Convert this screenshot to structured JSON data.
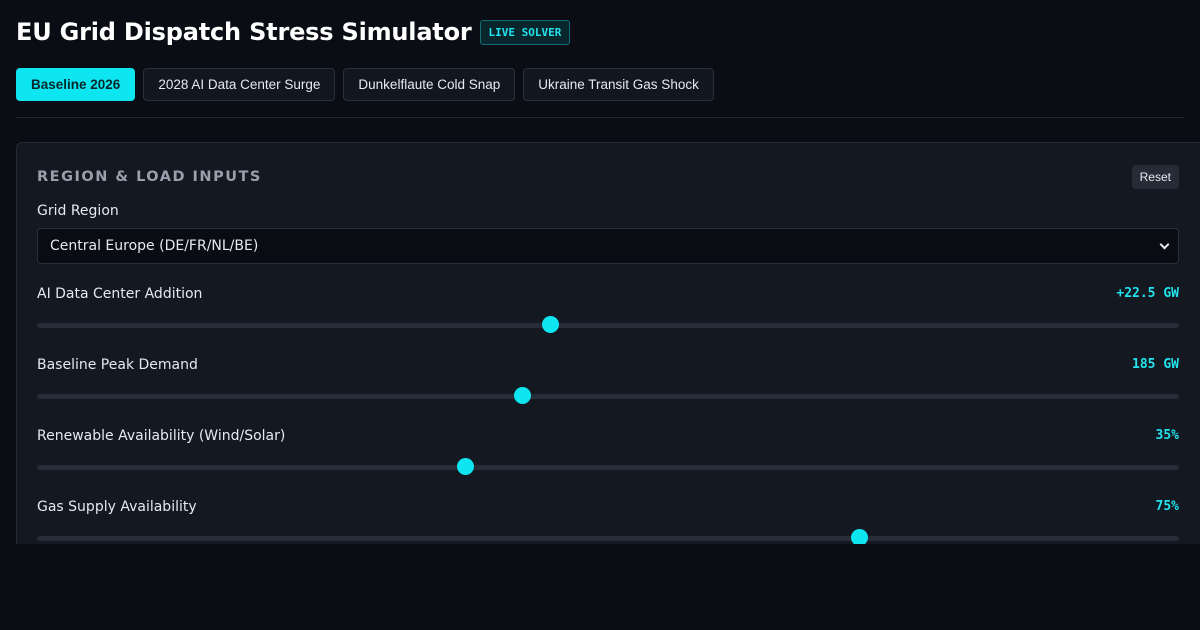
{
  "header": {
    "title": "EU Grid Dispatch Stress Simulator",
    "badge": "LIVE SOLVER"
  },
  "tabs": [
    {
      "label": "Baseline 2026",
      "active": true
    },
    {
      "label": "2028 AI Data Center Surge",
      "active": false
    },
    {
      "label": "Dunkelflaute Cold Snap",
      "active": false
    },
    {
      "label": "Ukraine Transit Gas Shock",
      "active": false
    }
  ],
  "panel": {
    "title": "REGION & LOAD INPUTS",
    "reset_label": "Reset",
    "region": {
      "label": "Grid Region",
      "selected": "Central Europe (DE/FR/NL/BE)"
    },
    "sliders": [
      {
        "label": "AI Data Center Addition",
        "value_text": "+22.5 GW",
        "fraction": 0.45
      },
      {
        "label": "Baseline Peak Demand",
        "value_text": "185 GW",
        "fraction": 0.425
      },
      {
        "label": "Renewable Availability (Wind/Solar)",
        "value_text": "35%",
        "fraction": 0.375
      },
      {
        "label": "Gas Supply Availability",
        "value_text": "75%",
        "fraction": 0.72
      }
    ]
  },
  "colors": {
    "accent": "#0de6f0",
    "background": "#0a0d14",
    "panel": "#131821"
  }
}
